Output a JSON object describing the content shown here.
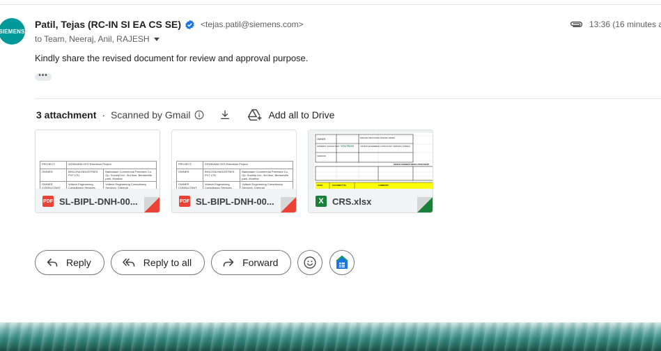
{
  "message": {
    "avatar_text": "SIEMENS",
    "sender_name": "Patil, Tejas (RC-IN SI EA CS SE)",
    "sender_email": "<tejas.patil@siemens.com>",
    "recipients": "to Team, Neeraj, Anil, RAJESH",
    "time": "13:36 (16 minutes ag",
    "body": "Kindly share the revised document for review and approval purpose.",
    "trimmed_label": "•••"
  },
  "attachments": {
    "count_label": "3 attachment",
    "scanned_label": "Scanned by Gmail",
    "add_all_label": "Add all to Drive",
    "items": [
      {
        "name": "SL-BIPL-DNH-00...",
        "type": "PDF",
        "badge_color": "#ea4335",
        "corner_color": "#ea4335"
      },
      {
        "name": "SL-BIPL-DNH-00...",
        "type": "PDF",
        "badge_color": "#ea4335",
        "corner_color": "#ea4335"
      },
      {
        "name": "CRS.xlsx",
        "type": "X",
        "badge_color": "#188038",
        "corner_color": "#188038"
      }
    ],
    "pdf_preview": {
      "rows": [
        [
          "PROJECT:",
          "2200kVA/kt CES Extension Project"
        ],
        [
          "OWNER:",
          "BHILOSA INDUSTRIES PVT LTD.",
          "Bakhatauri Commercial Premises Co. Op. Society Ltd., 3rd floor, Bentonville park, Mumbai"
        ],
        [
          "OWNER CONSULTANT:",
          "Voltech Engineering Consultancy Services, Chennai",
          "Voltech Engineering Consultancy Services, Chennai"
        ]
      ]
    },
    "xlsx_preview": {
      "owner": "OWNER",
      "owner_value": "BHILOSA INDUSTRIES PRIVATE LIMITED",
      "consultant": "OWNER'S CONSULTANT",
      "consultant_value": "VOLTECH ENGINEERING CONSULTANCY SERVICES, CHENNAI",
      "vendor": "VENDOR",
      "logo": "VOLTECH",
      "header_band": "DESIGN COMMENT RESOLUTION SHEET",
      "yellow_cols": [
        "SR.NO",
        "DOCUMENT NO.",
        "COMMENTS"
      ]
    }
  },
  "actions": {
    "reply": "Reply",
    "reply_all": "Reply to all",
    "forward": "Forward"
  }
}
